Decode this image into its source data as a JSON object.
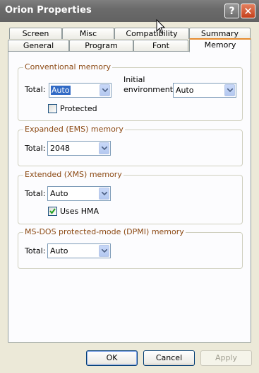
{
  "window": {
    "title": "Orion Properties",
    "help_glyph": "?",
    "close_glyph": "✕"
  },
  "tabs": {
    "row1": [
      {
        "label": "Screen"
      },
      {
        "label": "Misc"
      },
      {
        "label": "Compatibility"
      },
      {
        "label": "Summary"
      }
    ],
    "row2": [
      {
        "label": "General"
      },
      {
        "label": "Program"
      },
      {
        "label": "Font"
      },
      {
        "label": "Memory",
        "active": true
      }
    ]
  },
  "conventional": {
    "title": "Conventional memory",
    "total_label": "Total:",
    "total_value": "Auto",
    "initial_env_label_1": "Initial",
    "initial_env_label_2": "environment:",
    "initial_env_value": "Auto",
    "protected_label": "Protected",
    "protected_checked": false
  },
  "ems": {
    "title": "Expanded (EMS) memory",
    "total_label": "Total:",
    "total_value": "2048"
  },
  "xms": {
    "title": "Extended (XMS) memory",
    "total_label": "Total:",
    "total_value": "Auto",
    "uses_hma_label": "Uses HMA",
    "uses_hma_checked": true
  },
  "dpmi": {
    "title": "MS-DOS protected-mode (DPMI) memory",
    "total_label": "Total:",
    "total_value": "Auto"
  },
  "buttons": {
    "ok": "OK",
    "cancel": "Cancel",
    "apply": "Apply"
  },
  "colors": {
    "active_tab_accent": "#e68b2c",
    "group_title": "#8c4a14",
    "selection": "#316ac5"
  }
}
